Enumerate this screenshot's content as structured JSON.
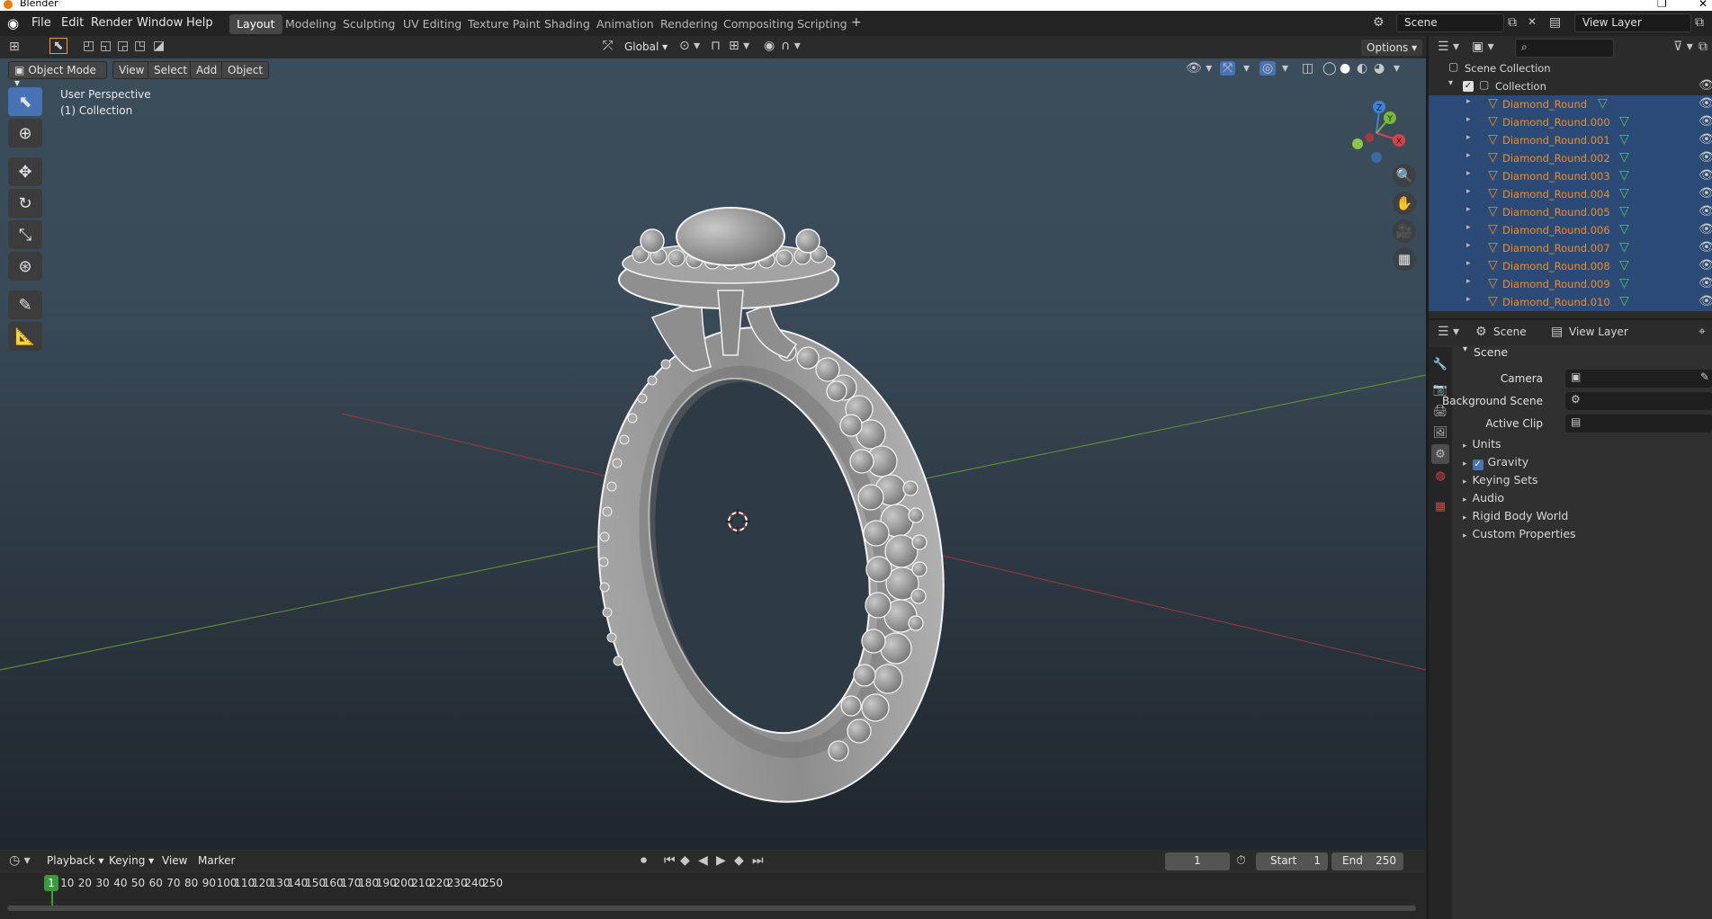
{
  "window": {
    "title": "Blender"
  },
  "menu": [
    "File",
    "Edit",
    "Render",
    "Window",
    "Help"
  ],
  "workspaces": [
    "Layout",
    "Modeling",
    "Sculpting",
    "UV Editing",
    "Texture Paint",
    "Shading",
    "Animation",
    "Rendering",
    "Compositing",
    "Scripting"
  ],
  "active_workspace": "Layout",
  "scene_selector": "Scene",
  "view_layer_selector": "View Layer",
  "tool_header": {
    "orientation": "Global",
    "options": "Options"
  },
  "viewport_header": {
    "mode": "Object Mode",
    "menus": [
      "View",
      "Select",
      "Add",
      "Object"
    ]
  },
  "viewport": {
    "perspective": "User Perspective",
    "collection": "(1) Collection",
    "gizmo_axes": {
      "z": "Z",
      "x": "X",
      "y": "Y"
    }
  },
  "tools": [
    {
      "name": "select-box",
      "icon": "cursor-icon",
      "active": true
    },
    {
      "name": "cursor",
      "icon": "crosshair-icon",
      "active": false
    },
    {
      "name": "move",
      "icon": "move-icon",
      "active": false
    },
    {
      "name": "rotate",
      "icon": "rotate-icon",
      "active": false
    },
    {
      "name": "scale",
      "icon": "scale-icon",
      "active": false
    },
    {
      "name": "transform",
      "icon": "transform-icon",
      "active": false
    },
    {
      "name": "annotate",
      "icon": "pencil-icon",
      "active": false
    },
    {
      "name": "measure",
      "icon": "ruler-icon",
      "active": false
    }
  ],
  "timeline": {
    "menus": [
      "Playback",
      "Keying",
      "View",
      "Marker"
    ],
    "current_frame": "1",
    "start_label": "Start",
    "start": "1",
    "end_label": "End",
    "end": "250",
    "ticks": [
      "1",
      "10",
      "20",
      "30",
      "40",
      "50",
      "60",
      "70",
      "80",
      "90",
      "100",
      "110",
      "120",
      "130",
      "140",
      "150",
      "160",
      "170",
      "180",
      "190",
      "200",
      "210",
      "220",
      "230",
      "240",
      "250"
    ]
  },
  "outliner": {
    "root": "Scene Collection",
    "collection": "Collection",
    "objects": [
      "Diamond_Round",
      "Diamond_Round.000",
      "Diamond_Round.001",
      "Diamond_Round.002",
      "Diamond_Round.003",
      "Diamond_Round.004",
      "Diamond_Round.005",
      "Diamond_Round.006",
      "Diamond_Round.007",
      "Diamond_Round.008",
      "Diamond_Round.009",
      "Diamond_Round.010"
    ],
    "object_color": "#f28b25",
    "selected_row_color": "#2c4a76"
  },
  "properties": {
    "scene_tab": "Scene",
    "view_layer_tab": "View Layer",
    "panel_title": "Scene",
    "fields": [
      {
        "label": "Camera",
        "value": ""
      },
      {
        "label": "Background Scene",
        "value": ""
      },
      {
        "label": "Active Clip",
        "value": ""
      }
    ],
    "subpanels": [
      "Units",
      "Gravity",
      "Keying Sets",
      "Audio",
      "Rigid Body World",
      "Custom Properties"
    ],
    "gravity_checked": true
  },
  "colors": {
    "accent": "#4772b3",
    "frame_marker": "#3b9b3b",
    "x_axis": "#d8424a",
    "y_axis": "#7ab83c",
    "z_axis": "#3e82d8"
  }
}
